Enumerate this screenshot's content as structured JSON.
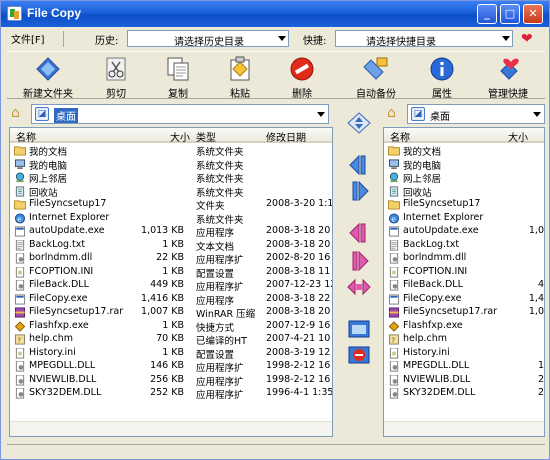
{
  "window": {
    "title": "File Copy"
  },
  "menu": {
    "file": "文件[F]",
    "history_label": "历史:",
    "history_value": "请选择历史目录",
    "shortcut_label": "快捷:",
    "shortcut_value": "请选择快捷目录"
  },
  "toolbar": [
    {
      "label": "新建文件夹",
      "icon": "new-folder-icon"
    },
    {
      "label": "剪切",
      "icon": "scissors-icon"
    },
    {
      "label": "复制",
      "icon": "copy-icon"
    },
    {
      "label": "粘贴",
      "icon": "paste-icon"
    },
    {
      "label": "删除",
      "icon": "delete-icon"
    },
    {
      "label": "自动备份",
      "icon": "backup-icon"
    },
    {
      "label": "属性",
      "icon": "info-icon"
    },
    {
      "label": "管理快捷",
      "icon": "heart-icon"
    }
  ],
  "left": {
    "path": "桌面",
    "columns": {
      "name": "名称",
      "size": "大小",
      "type": "类型",
      "date": "修改日期"
    },
    "rows": [
      {
        "name": "我的文档",
        "size": "",
        "type": "系统文件夹",
        "date": "",
        "icon": "folder"
      },
      {
        "name": "我的电脑",
        "size": "",
        "type": "系统文件夹",
        "date": "",
        "icon": "computer"
      },
      {
        "name": "网上邻居",
        "size": "",
        "type": "系统文件夹",
        "date": "",
        "icon": "network"
      },
      {
        "name": "回收站",
        "size": "",
        "type": "系统文件夹",
        "date": "",
        "icon": "recycle"
      },
      {
        "name": "FileSyncsetup17",
        "size": "",
        "type": "文件夹",
        "date": "2008-3-20 1:1",
        "icon": "folder"
      },
      {
        "name": "Internet Explorer",
        "size": "",
        "type": "系统文件夹",
        "date": "",
        "icon": "ie"
      },
      {
        "name": "autoUpdate.exe",
        "size": "1,013 KB",
        "type": "应用程序",
        "date": "2008-3-18 20",
        "icon": "exe"
      },
      {
        "name": "BackLog.txt",
        "size": "1 KB",
        "type": "文本文档",
        "date": "2008-3-18 20",
        "icon": "txt"
      },
      {
        "name": "borlndmm.dll",
        "size": "22 KB",
        "type": "应用程序扩",
        "date": "2002-8-20 16",
        "icon": "dll"
      },
      {
        "name": "FCOPTION.INI",
        "size": "1 KB",
        "type": "配置设置",
        "date": "2008-3-18 11",
        "icon": "ini"
      },
      {
        "name": "FileBack.DLL",
        "size": "449 KB",
        "type": "应用程序扩",
        "date": "2007-12-23 12",
        "icon": "dll"
      },
      {
        "name": "FileCopy.exe",
        "size": "1,416 KB",
        "type": "应用程序",
        "date": "2008-3-18 22",
        "icon": "exe"
      },
      {
        "name": "FileSyncsetup17.rar",
        "size": "1,007 KB",
        "type": "WinRAR 压缩",
        "date": "2008-3-18 20",
        "icon": "rar"
      },
      {
        "name": "Flashfxp.exe",
        "size": "1 KB",
        "type": "快捷方式",
        "date": "2007-12-9 16",
        "icon": "shortcut"
      },
      {
        "name": "help.chm",
        "size": "70 KB",
        "type": "已编译的HT",
        "date": "2007-4-21 10",
        "icon": "chm"
      },
      {
        "name": "History.ini",
        "size": "1 KB",
        "type": "配置设置",
        "date": "2008-3-19 12",
        "icon": "ini"
      },
      {
        "name": "MPEGDLL.DLL",
        "size": "146 KB",
        "type": "应用程序扩",
        "date": "1998-2-12 16",
        "icon": "dll"
      },
      {
        "name": "NVIEWLIB.DLL",
        "size": "256 KB",
        "type": "应用程序扩",
        "date": "1998-2-12 16",
        "icon": "dll"
      },
      {
        "name": "SKY32DEM.DLL",
        "size": "252 KB",
        "type": "应用程序扩",
        "date": "1996-4-1 1:35",
        "icon": "dll"
      }
    ]
  },
  "right": {
    "path": "桌面",
    "columns": {
      "name": "名称",
      "size": "大小"
    },
    "rows": [
      {
        "name": "我的文档",
        "size": "",
        "icon": "folder"
      },
      {
        "name": "我的电脑",
        "size": "",
        "icon": "computer"
      },
      {
        "name": "网上邻居",
        "size": "",
        "icon": "network"
      },
      {
        "name": "回收站",
        "size": "",
        "icon": "recycle"
      },
      {
        "name": "FileSyncsetup17",
        "size": "",
        "icon": "folder"
      },
      {
        "name": "Internet Explorer",
        "size": "",
        "icon": "ie"
      },
      {
        "name": "autoUpdate.exe",
        "size": "1,0",
        "icon": "exe"
      },
      {
        "name": "BackLog.txt",
        "size": "",
        "icon": "txt"
      },
      {
        "name": "borlndmm.dll",
        "size": "",
        "icon": "dll"
      },
      {
        "name": "FCOPTION.INI",
        "size": "",
        "icon": "ini"
      },
      {
        "name": "FileBack.DLL",
        "size": "4",
        "icon": "dll"
      },
      {
        "name": "FileCopy.exe",
        "size": "1,4",
        "icon": "exe"
      },
      {
        "name": "FileSyncsetup17.rar",
        "size": "1,0",
        "icon": "rar"
      },
      {
        "name": "Flashfxp.exe",
        "size": "",
        "icon": "shortcut"
      },
      {
        "name": "help.chm",
        "size": "",
        "icon": "chm"
      },
      {
        "name": "History.ini",
        "size": "",
        "icon": "ini"
      },
      {
        "name": "MPEGDLL.DLL",
        "size": "1",
        "icon": "dll"
      },
      {
        "name": "NVIEWLIB.DLL",
        "size": "2",
        "icon": "dll"
      },
      {
        "name": "SKY32DEM.DLL",
        "size": "2",
        "icon": "dll"
      }
    ]
  }
}
